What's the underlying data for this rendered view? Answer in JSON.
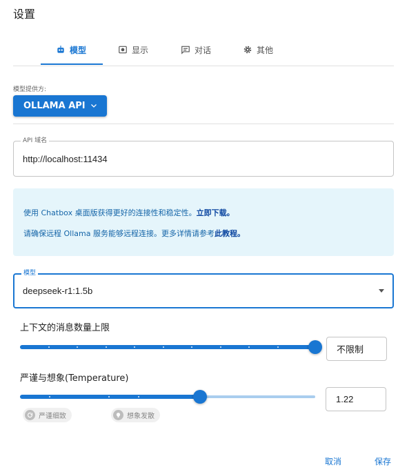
{
  "dialog": {
    "title": "设置"
  },
  "tabs": [
    {
      "label": "模型",
      "icon": "robot-icon",
      "active": true
    },
    {
      "label": "显示",
      "icon": "display-icon",
      "active": false
    },
    {
      "label": "对话",
      "icon": "chat-icon",
      "active": false
    },
    {
      "label": "其他",
      "icon": "gear-icon",
      "active": false
    }
  ],
  "provider": {
    "label": "模型提供方:",
    "value": "OLLAMA API"
  },
  "api_host": {
    "label": "API 域名",
    "value": "http://localhost:11434"
  },
  "info": {
    "line1_text": "使用 Chatbox 桌面版获得更好的连接性和稳定性。",
    "line1_link": "立即下载。",
    "line2_text": "请确保远程 Ollama 服务能够远程连接。更多详情请参考",
    "line2_link": "此教程。"
  },
  "model": {
    "label": "模型",
    "value": "deepseek-r1:1.5b"
  },
  "context_limit": {
    "label": "上下文的消息数量上限",
    "value_text": "不限制",
    "fraction": 1.0
  },
  "temperature": {
    "label": "严谨与想象(Temperature)",
    "value": "1.22",
    "fraction": 0.61
  },
  "chips": {
    "strict": "严谨细致",
    "creative": "想象发散"
  },
  "actions": {
    "cancel": "取消",
    "save": "保存"
  },
  "colors": {
    "accent": "#1976d2",
    "info_bg": "#e5f5fb"
  }
}
